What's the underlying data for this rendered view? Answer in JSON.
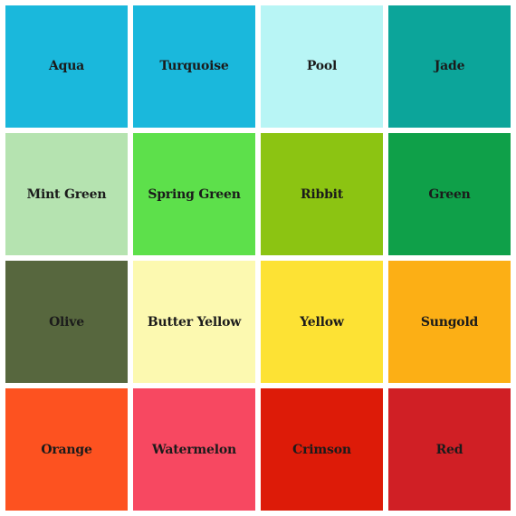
{
  "swatches": [
    {
      "label": "Aqua",
      "color": "#1ab8dc"
    },
    {
      "label": "Turquoise",
      "color": "#1ab8dc"
    },
    {
      "label": "Pool",
      "color": "#b8f5f5"
    },
    {
      "label": "Jade",
      "color": "#0ca59a"
    },
    {
      "label": "Mint Green",
      "color": "#b5e3b0"
    },
    {
      "label": "Spring Green",
      "color": "#5de04b"
    },
    {
      "label": "Ribbit",
      "color": "#8cc412"
    },
    {
      "label": "Green",
      "color": "#0fa049"
    },
    {
      "label": "Olive",
      "color": "#57673e"
    },
    {
      "label": "Butter Yellow",
      "color": "#fcf9b0"
    },
    {
      "label": "Yellow",
      "color": "#fde234"
    },
    {
      "label": "Sungold",
      "color": "#fcaf15"
    },
    {
      "label": "Orange",
      "color": "#fd5220"
    },
    {
      "label": "Watermelon",
      "color": "#f74861"
    },
    {
      "label": "Crimson",
      "color": "#dd1b08"
    },
    {
      "label": "Red",
      "color": "#d01f25"
    }
  ]
}
